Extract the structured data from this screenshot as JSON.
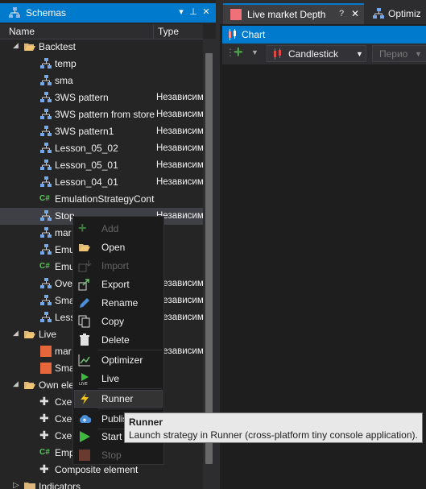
{
  "schemas_panel": {
    "title": "Schemas",
    "col_name": "Name",
    "col_type": "Type",
    "pin_glyph": "⊿",
    "close_glyph": "✕"
  },
  "tree": {
    "backtest": "Backtest",
    "items": [
      {
        "label": "temp",
        "type": ""
      },
      {
        "label": "sma",
        "type": ""
      },
      {
        "label": "3WS pattern",
        "type": "Независим"
      },
      {
        "label": "3WS pattern from store",
        "type": "Независим"
      },
      {
        "label": "3WS pattern1",
        "type": "Независим"
      },
      {
        "label": "Lesson_05_02",
        "type": "Независим"
      },
      {
        "label": "Lesson_05_01",
        "type": "Независим"
      },
      {
        "label": "Lesson_04_01",
        "type": "Независим"
      },
      {
        "label": "EmulationStrategyCont",
        "type": ""
      },
      {
        "label": "Stop",
        "type": "Независим"
      },
      {
        "label": "mar",
        "type": ""
      },
      {
        "label": "Emu",
        "type": ""
      },
      {
        "label": "Emu",
        "type": ""
      },
      {
        "label": "Ove",
        "type": "Независим"
      },
      {
        "label": "Sma",
        "type": "Независим"
      },
      {
        "label": "Less",
        "type": "Независим"
      }
    ],
    "live": "Live",
    "live_items": [
      {
        "label": "mar",
        "type": "Независим"
      },
      {
        "label": "Sma",
        "type": ""
      }
    ],
    "own_elements": "Own ele",
    "own_items": [
      {
        "label": "Cxer"
      },
      {
        "label": "Cxer"
      },
      {
        "label": "Cxer"
      },
      {
        "label": "Emp"
      },
      {
        "label": "Composite element"
      }
    ],
    "indicators": "Indicators"
  },
  "doc_tabs": {
    "market_depth": "Live market Depth",
    "optimization": "Optimiz",
    "close_glyph": "✕",
    "help_glyph": "?"
  },
  "chart": {
    "title": "Chart",
    "style": "Candlestick",
    "period_placeholder": "Перио"
  },
  "context_menu": {
    "items": [
      {
        "label": "Add",
        "enabled": false,
        "icon": "plus-icon"
      },
      {
        "label": "Open",
        "enabled": true,
        "icon": "folder-open-icon"
      },
      {
        "label": "Import",
        "enabled": false,
        "icon": "import-icon"
      },
      {
        "label": "Export",
        "enabled": true,
        "icon": "export-icon"
      },
      {
        "label": "Rename",
        "enabled": true,
        "icon": "pencil-icon"
      },
      {
        "label": "Copy",
        "enabled": true,
        "icon": "copy-icon"
      },
      {
        "label": "Delete",
        "enabled": true,
        "icon": "trash-icon"
      },
      {
        "label": "Optimizer",
        "enabled": true,
        "icon": "chart-line-icon"
      },
      {
        "label": "Live",
        "enabled": true,
        "icon": "live-play-icon"
      },
      {
        "label": "Runner",
        "enabled": true,
        "icon": "lightning-icon"
      },
      {
        "label": "Publish",
        "enabled": true,
        "icon": "cloud-upload-icon"
      },
      {
        "label": "Start",
        "enabled": true,
        "icon": "play-icon"
      },
      {
        "label": "Stop",
        "enabled": false,
        "icon": "stop-icon"
      }
    ]
  },
  "tooltip": {
    "title": "Runner",
    "text": "Launch strategy in Runner (cross-platform tiny console application)."
  },
  "colors": {
    "accent": "#007acc",
    "panel_bg": "#252526",
    "menu_bg": "#1b1b1c",
    "market_depth_swatch": "#f0707a",
    "live_item_swatch": "#e8663c"
  }
}
